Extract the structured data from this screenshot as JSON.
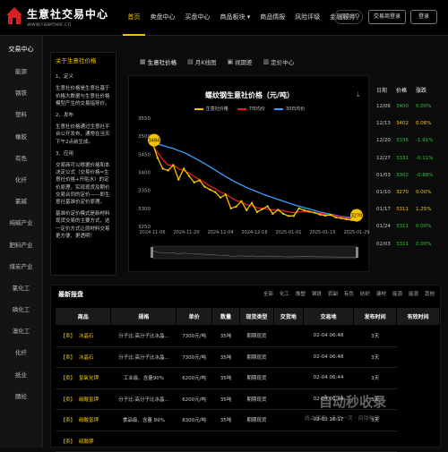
{
  "header": {
    "logo_name": "生意社交易中心",
    "logo_url": "www.rawmex.cn",
    "nav": [
      "首页",
      "卖盘中心",
      "买盘中心",
      "商品板块 ▾",
      "商品情报",
      "风险评级",
      "金融服务"
    ],
    "nav_active": 0,
    "search_placeholder": "商品搜",
    "exchange_btn": "交易商登录",
    "user_btn": "登录"
  },
  "sidebar": {
    "head": "交易中心",
    "items": [
      "能源",
      "钢铁",
      "塑料",
      "橡胶",
      "有色",
      "化纤",
      "氯碱",
      "纯碱产业",
      "肥料产业",
      "煤炭产业",
      "氯化工",
      "磷化工",
      "溴化工",
      "化纤",
      "纸业",
      "腈纶"
    ]
  },
  "intro": {
    "title": "关于生意社价格",
    "paras": [
      "1、定义",
      "生意社价格是生意社基于价格大数据与生意社价格模型产生的交易指导价。",
      "2、发布",
      "生意社价格通过生意社平台公开发布，通常在当天下午2点前生成。",
      "3、应用",
      "交易商可以根据价格和本决定公式（交易价格=生意社价格+升贴水）的定价原理，实现现货及期价交易合同的定价——即生意社基准价定价原理。",
      "基准价定价模式是新材料现货交易的主要方式，这一定价方式让原材料交易更方便、更透明！"
    ]
  },
  "tabs": [
    "生意社价格",
    "月K线图",
    "视期差",
    "定价中心"
  ],
  "chart_data": {
    "type": "line",
    "title": "螺纹钢生意社价格（元/吨）",
    "series": [
      {
        "name": "生意社价格",
        "color": "#f5c400",
        "values": [
          3484,
          3440,
          3410,
          3405,
          3420,
          3380,
          3410,
          3390,
          3372,
          3378,
          3360,
          3352,
          3345,
          3330,
          3338,
          3300,
          3305,
          3320,
          3295,
          3315,
          3290,
          3298,
          3306,
          3285,
          3296,
          3285,
          3279,
          3279,
          3300,
          3295,
          3291,
          3288,
          3283,
          3280,
          3282,
          3275,
          3273,
          3270,
          3268,
          3266
        ]
      },
      {
        "name": "7日均价",
        "color": "#e02020",
        "values": [
          3475,
          3455,
          3435,
          3420,
          3420,
          3410,
          3405,
          3398,
          3388,
          3380,
          3372,
          3362,
          3355,
          3345,
          3340,
          3330,
          3322,
          3318,
          3310,
          3308,
          3302,
          3300,
          3298,
          3296,
          3295,
          3294,
          3290,
          3288,
          3290,
          3291,
          3290,
          3288,
          3286,
          3284,
          3282,
          3280,
          3277,
          3274,
          3271,
          3269
        ]
      },
      {
        "name": "30日均价",
        "color": "#3aa0ff",
        "values": [
          3480,
          3478,
          3474,
          3470,
          3466,
          3460,
          3455,
          3448,
          3440,
          3432,
          3424,
          3415,
          3406,
          3397,
          3388,
          3380,
          3372,
          3365,
          3358,
          3352,
          3346,
          3340,
          3335,
          3330,
          3325,
          3320,
          3315,
          3310,
          3306,
          3302,
          3298,
          3294,
          3290,
          3287,
          3284,
          3281,
          3278,
          3276,
          3274,
          3272
        ]
      }
    ],
    "xticks": [
      "2024-11-06",
      "2024-11-20",
      "2024-12-04",
      "2024-12-18",
      "2025-01-01",
      "2025-01-15",
      "2025-01-29"
    ],
    "ylim": [
      3250,
      3550
    ],
    "yticks": [
      3250,
      3300,
      3350,
      3400,
      3450,
      3500,
      3550
    ],
    "max_label": "3484",
    "min_label": "3270",
    "grid": false
  },
  "price_table": {
    "headers": [
      "日期",
      "价格",
      "涨跌"
    ],
    "rows": [
      {
        "date": "12/06",
        "price": "3400",
        "chg": "0.00%",
        "dir": "up"
      },
      {
        "date": "12/13",
        "price": "3402",
        "chg": "0.06%",
        "dir": "down"
      },
      {
        "date": "12/20",
        "price": "3335",
        "chg": "-1.91%",
        "dir": "up"
      },
      {
        "date": "12/27",
        "price": "3331",
        "chg": "-0.11%",
        "dir": "up"
      },
      {
        "date": "01/03",
        "price": "3302",
        "chg": "-0.88%",
        "dir": "up"
      },
      {
        "date": "01/10",
        "price": "3270",
        "chg": "0.00%",
        "dir": "down"
      },
      {
        "date": "01/17",
        "price": "3311",
        "chg": "1.25%",
        "dir": "down"
      },
      {
        "date": "01/24",
        "price": "3311",
        "chg": "0.00%",
        "dir": "up"
      },
      {
        "date": "02/03",
        "price": "3311",
        "chg": "0.00%",
        "dir": "up"
      }
    ]
  },
  "market": {
    "title": "最新报盘",
    "filters": [
      "全部",
      "化工",
      "橡塑",
      "钢铁",
      "农副",
      "有色",
      "纺织",
      "建材",
      "能源",
      "能源",
      "其他"
    ],
    "headers": [
      "商品",
      "规格",
      "单价",
      "数量",
      "现货类型",
      "交货地",
      "交易地",
      "发布时间",
      "有效时间"
    ],
    "rows": [
      [
        "【卖】",
        "冰晶石",
        "分子比:高分子比冰晶...",
        "7300元/吨",
        "35吨",
        "期期现货",
        "",
        "山东省 > 济宁市",
        "02-04 06:48",
        "3天"
      ],
      [
        "【卖】",
        "冰晶石",
        "分子比:高分子比冰晶...",
        "7300元/吨",
        "35吨",
        "期期现货",
        "",
        "山东省 > 济宁市",
        "02-04 06:48",
        "3天"
      ],
      [
        "【卖】",
        "氢氧化钾",
        "工业级、含量90%",
        "6200元/吨",
        "35吨",
        "期期现货",
        "",
        "青海省 > 海西蒙古...",
        "02-04 06:44",
        "3天"
      ],
      [
        "【卖】",
        "碳酸氢钾",
        "分子比:高分子比冰晶...",
        "6200元/吨",
        "35吨",
        "期期现货",
        "",
        "山东省 > 济宁市",
        "02-04 06:48",
        "3天"
      ],
      [
        "【卖】",
        "碳酸氢钾",
        "食品级、含量 99%",
        "8300元/吨",
        "35吨",
        "期期现货",
        "",
        "浙江省 > 杭州市",
        "02-03 16:17",
        "3天"
      ],
      [
        "【卖】",
        "硫酸钾",
        "",
        "",
        "",
        "",
        "",
        "",
        "",
        ""
      ]
    ]
  },
  "watermark": {
    "big": "自动秒收录",
    "small": "线上接连 · 未动一次 · 自动收录"
  }
}
